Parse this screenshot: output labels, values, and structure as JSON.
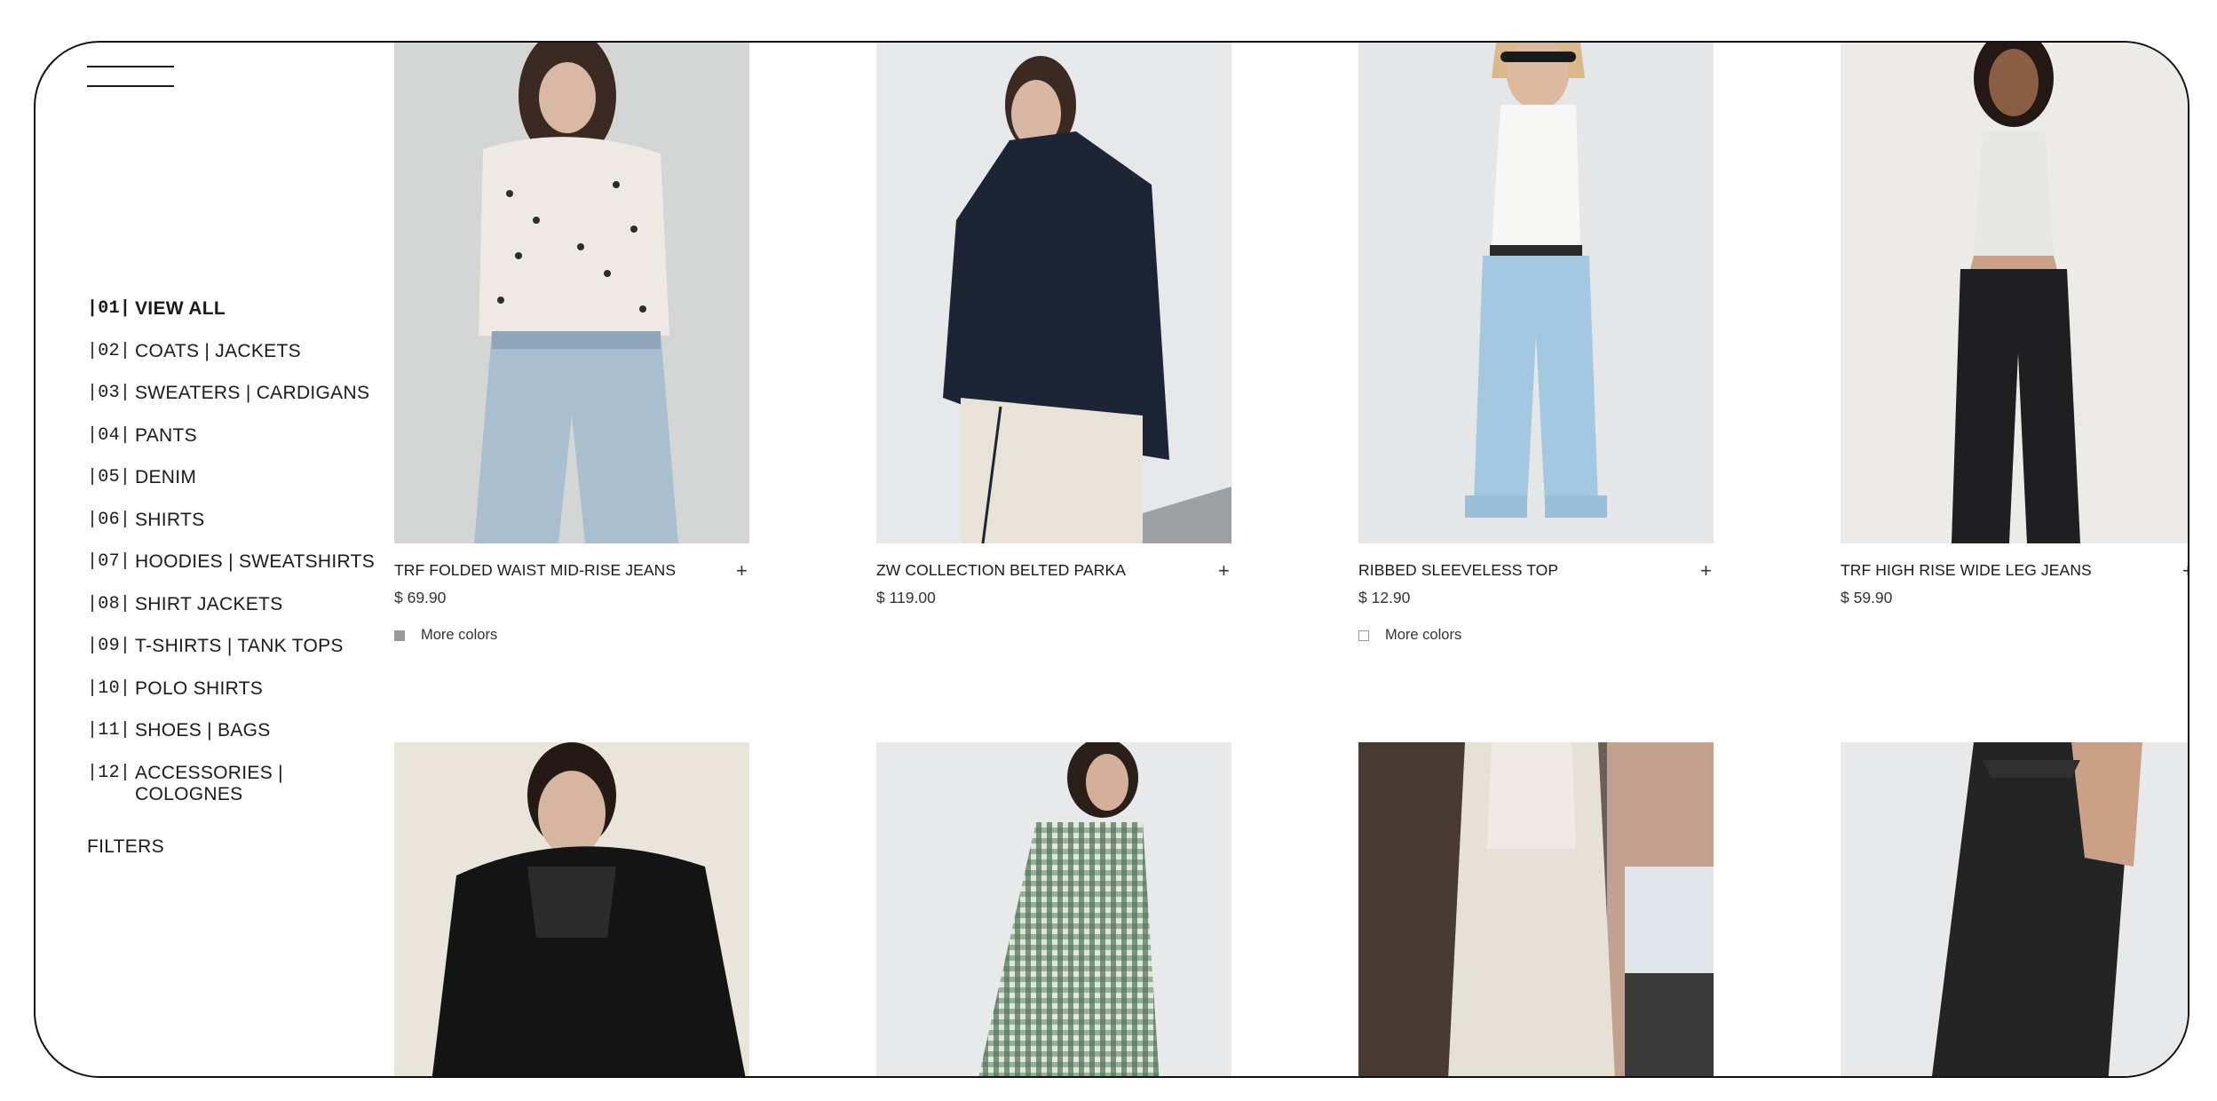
{
  "sidebar": {
    "categories": [
      {
        "num": "|01|",
        "label": "VIEW ALL"
      },
      {
        "num": "|02|",
        "label": "COATS | JACKETS"
      },
      {
        "num": "|03|",
        "label": "SWEATERS | CARDIGANS"
      },
      {
        "num": "|04|",
        "label": "PANTS"
      },
      {
        "num": "|05|",
        "label": "DENIM"
      },
      {
        "num": "|06|",
        "label": "SHIRTS"
      },
      {
        "num": "|07|",
        "label": "HOODIES | SWEATSHIRTS"
      },
      {
        "num": "|08|",
        "label": "SHIRT JACKETS"
      },
      {
        "num": "|09|",
        "label": "T-SHIRTS | TANK TOPS"
      },
      {
        "num": "|10|",
        "label": "POLO SHIRTS"
      },
      {
        "num": "|11|",
        "label": "SHOES | BAGS"
      },
      {
        "num": "|12|",
        "label": "ACCESSORIES | COLOGNES"
      }
    ],
    "filters_label": "FILTERS"
  },
  "products": [
    {
      "name": "TRF FOLDED WAIST MID-RISE JEANS",
      "price": "$ 69.90",
      "more_colors": "More colors",
      "swatch_color": "#9a9a9a"
    },
    {
      "name": "ZW COLLECTION BELTED PARKA",
      "price": "$ 119.00",
      "more_colors": "",
      "swatch_color": ""
    },
    {
      "name": "RIBBED SLEEVELESS TOP",
      "price": "$ 12.90",
      "more_colors": "More colors",
      "swatch_color": "#ffffff"
    },
    {
      "name": "TRF HIGH RISE WIDE LEG JEANS",
      "price": "$ 59.90",
      "more_colors": "",
      "swatch_color": ""
    }
  ],
  "colors": {
    "frame_border": "#111111",
    "text": "#1a1a1a",
    "background": "#ffffff"
  }
}
